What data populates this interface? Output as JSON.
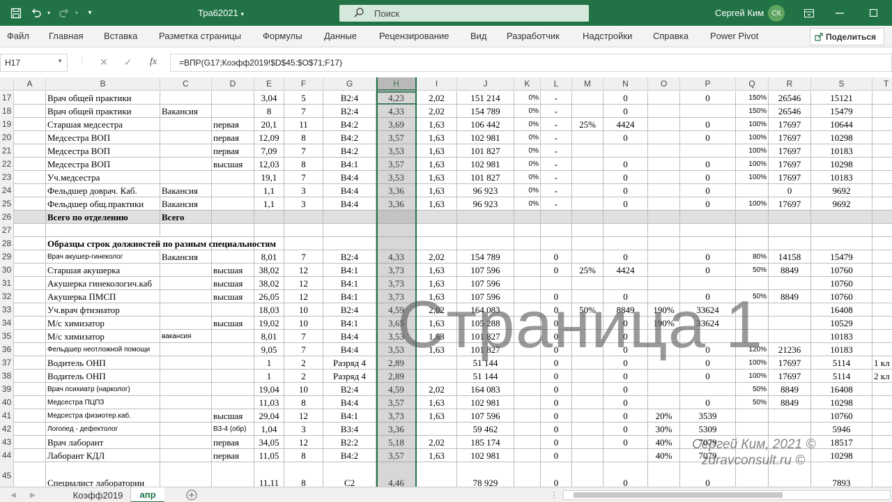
{
  "titlebar": {
    "file_title": "Тра62021",
    "search_placeholder": "Поиск",
    "user_name": "Сергей Ким",
    "user_initials": "СК",
    "save_icon": "save-icon",
    "undo_icon": "undo-icon",
    "redo_icon": "redo-icon",
    "customize_icon": "chevron-down-icon",
    "ribbon_display_icon": "ribbon-display-icon",
    "minimize_icon": "minimize-icon",
    "maximize_icon": "maximize-icon",
    "accent_color": "#217346"
  },
  "ribbon": {
    "tabs": [
      "Файл",
      "Главная",
      "Вставка",
      "Разметка страницы",
      "Формулы",
      "Данные",
      "Рецензирование",
      "Вид",
      "Разработчик",
      "Надстройки",
      "Справка",
      "Power Pivot"
    ],
    "share_label": "Поделиться"
  },
  "formula_bar": {
    "cell_ref": "H17",
    "fx_label": "fx",
    "formula": "=ВПР(G17;Коэфф2019!$D$45:$O$71;F17)"
  },
  "grid": {
    "columns": [
      "A",
      "B",
      "C",
      "D",
      "E",
      "F",
      "G",
      "H",
      "I",
      "J",
      "K",
      "L",
      "M",
      "N",
      "O",
      "P",
      "Q",
      "R",
      "S",
      "T"
    ],
    "selected_column": "H",
    "rows": [
      {
        "num": "17",
        "cells": [
          "",
          "Врач общей практики",
          "",
          "",
          "3,04",
          "5",
          "В2:4",
          "4,23",
          "2,02",
          "151 214",
          "0%",
          "-",
          "",
          "0",
          "",
          "0",
          "150%",
          "26546",
          "15121",
          ""
        ]
      },
      {
        "num": "18",
        "cells": [
          "",
          "Врач общей практики",
          "Вакансия",
          "",
          "8",
          "7",
          "В2:4",
          "4,33",
          "2,02",
          "154 789",
          "0%",
          "-",
          "",
          "0",
          "",
          "",
          "150%",
          "26546",
          "15479",
          ""
        ]
      },
      {
        "num": "19",
        "cells": [
          "",
          "Старшая медсестра",
          "",
          "первая",
          "20,1",
          "11",
          "В4:2",
          "3,69",
          "1,63",
          "106 442",
          "0%",
          "-",
          "25%",
          "4424",
          "",
          "0",
          "100%",
          "17697",
          "10644",
          ""
        ]
      },
      {
        "num": "20",
        "cells": [
          "",
          "Медсестра ВОП",
          "",
          "первая",
          "12,09",
          "8",
          "В4:2",
          "3,57",
          "1,63",
          "102 981",
          "0%",
          "-",
          "",
          "0",
          "",
          "0",
          "100%",
          "17697",
          "10298",
          ""
        ]
      },
      {
        "num": "21",
        "cells": [
          "",
          "Медсестра ВОП",
          "",
          "первая",
          "7,09",
          "7",
          "В4:2",
          "3,53",
          "1,63",
          "101 827",
          "0%",
          "-",
          "",
          "",
          "",
          "",
          "100%",
          "17697",
          "10183",
          ""
        ]
      },
      {
        "num": "22",
        "cells": [
          "",
          "Медсестра ВОП",
          "",
          "высшая",
          "12,03",
          "8",
          "В4:1",
          "3,57",
          "1,63",
          "102 981",
          "0%",
          "-",
          "",
          "0",
          "",
          "0",
          "100%",
          "17697",
          "10298",
          ""
        ]
      },
      {
        "num": "23",
        "cells": [
          "",
          "Уч.медсестра",
          "",
          "",
          "19,1",
          "7",
          "В4:4",
          "3,53",
          "1,63",
          "101 827",
          "0%",
          "-",
          "",
          "0",
          "",
          "0",
          "100%",
          "17697",
          "10183",
          ""
        ]
      },
      {
        "num": "24",
        "cells": [
          "",
          "Фельдшер доврач. Каб.",
          "Вакансия",
          "",
          "1,1",
          "3",
          "В4:4",
          "3,36",
          "1,63",
          "96 923",
          "0%",
          "-",
          "",
          "0",
          "",
          "0",
          "",
          "0",
          "9692",
          ""
        ]
      },
      {
        "num": "25",
        "cells": [
          "",
          "Фельдшер общ.практики",
          "Вакансия",
          "",
          "1,1",
          "3",
          "В4:4",
          "3,36",
          "1,63",
          "96 923",
          "0%",
          "-",
          "",
          "0",
          "",
          "0",
          "100%",
          "17697",
          "9692",
          ""
        ]
      },
      {
        "num": "26",
        "cells": [
          "",
          "Всего по отделению",
          "Всего",
          "",
          "",
          "",
          "",
          "",
          "",
          "",
          "",
          "",
          "",
          "",
          "",
          "",
          "",
          "",
          "",
          ""
        ]
      },
      {
        "num": "27",
        "cells": [
          "",
          "",
          "",
          "",
          "",
          "",
          "",
          "",
          "",
          "",
          "",
          "",
          "",
          "",
          "",
          "",
          "",
          "",
          "",
          ""
        ]
      },
      {
        "num": "28",
        "cells": [
          "",
          "Образцы строк должностей по разным специальностям",
          "",
          "",
          "",
          "",
          "",
          "",
          "",
          "",
          "",
          "",
          "",
          "",
          "",
          "",
          "",
          "",
          "",
          ""
        ]
      },
      {
        "num": "29",
        "cells": [
          "",
          "Врач акушер-гинеколог",
          "Вакансия",
          "",
          "8,01",
          "7",
          "В2:4",
          "4,33",
          "2,02",
          "154 789",
          "",
          "0",
          "",
          "0",
          "",
          "0",
          "80%",
          "14158",
          "15479",
          ""
        ]
      },
      {
        "num": "30",
        "cells": [
          "",
          "Старшая акушерка",
          "",
          "высшая",
          "38,02",
          "12",
          "В4:1",
          "3,73",
          "1,63",
          "107 596",
          "",
          "0",
          "25%",
          "4424",
          "",
          "0",
          "50%",
          "8849",
          "10760",
          ""
        ]
      },
      {
        "num": "31",
        "cells": [
          "",
          "Акушерка гинекологич.каб",
          "",
          "высшая",
          "38,02",
          "12",
          "В4:1",
          "3,73",
          "1,63",
          "107 596",
          "",
          "",
          "",
          "",
          "",
          "",
          "",
          "",
          "10760",
          ""
        ]
      },
      {
        "num": "32",
        "cells": [
          "",
          "Акушерка ПМСП",
          "",
          "высшая",
          "26,05",
          "12",
          "В4:1",
          "3,73",
          "1,63",
          "107 596",
          "",
          "0",
          "",
          "0",
          "",
          "0",
          "50%",
          "8849",
          "10760",
          ""
        ]
      },
      {
        "num": "33",
        "cells": [
          "",
          "Уч.врач фтизиатор",
          "",
          "",
          "18,03",
          "10",
          "В2:4",
          "4,59",
          "2,02",
          "164 083",
          "",
          "0",
          "50%",
          "8849",
          "190%",
          "33624",
          "",
          "",
          "16408",
          ""
        ]
      },
      {
        "num": "34",
        "cells": [
          "",
          "М/с химизатор",
          "",
          "высшая",
          "19,02",
          "10",
          "В4:1",
          "3,65",
          "1,63",
          "105 288",
          "",
          "0",
          "",
          "0",
          "190%",
          "33624",
          "",
          "",
          "10529",
          ""
        ]
      },
      {
        "num": "35",
        "cells": [
          "",
          "М/с химизатор",
          "вакансия",
          "",
          "8,01",
          "7",
          "В4:4",
          "3,53",
          "1,63",
          "101 827",
          "",
          "0",
          "",
          "0",
          "",
          "",
          "",
          "",
          "10183",
          ""
        ]
      },
      {
        "num": "36",
        "cells": [
          "",
          "Фельдшер неотложной помощи",
          "",
          "",
          "9,05",
          "7",
          "В4:4",
          "3,53",
          "1,63",
          "101 827",
          "",
          "0",
          "",
          "0",
          "",
          "0",
          "120%",
          "21236",
          "10183",
          ""
        ]
      },
      {
        "num": "37",
        "cells": [
          "",
          "Водитель ОНП",
          "",
          "",
          "1",
          "2",
          "Разряд 4",
          "2,89",
          "",
          "51 144",
          "",
          "0",
          "",
          "0",
          "",
          "0",
          "100%",
          "17697",
          "5114",
          "1 кл"
        ]
      },
      {
        "num": "38",
        "cells": [
          "",
          "Водитель ОНП",
          "",
          "",
          "1",
          "2",
          "Разряд 4",
          "2,89",
          "",
          "51 144",
          "",
          "0",
          "",
          "0",
          "",
          "0",
          "100%",
          "17697",
          "5114",
          "2 кл"
        ]
      },
      {
        "num": "39",
        "cells": [
          "",
          "Врач психиатр (нарколог)",
          "",
          "",
          "19,04",
          "10",
          "В2:4",
          "4,59",
          "2,02",
          "164 083",
          "",
          "0",
          "",
          "0",
          "",
          "",
          "50%",
          "8849",
          "16408",
          ""
        ]
      },
      {
        "num": "40",
        "cells": [
          "",
          "Медсестра ПЦПЗ",
          "",
          "",
          "11,03",
          "8",
          "В4:4",
          "3,57",
          "1,63",
          "102 981",
          "",
          "0",
          "",
          "0",
          "",
          "0",
          "50%",
          "8849",
          "10298",
          ""
        ]
      },
      {
        "num": "41",
        "cells": [
          "",
          "Медсестра физиотер.каб.",
          "",
          "высшая",
          "29,04",
          "12",
          "В4:1",
          "3,73",
          "1,63",
          "107 596",
          "",
          "0",
          "",
          "0",
          "20%",
          "3539",
          "",
          "",
          "10760",
          ""
        ]
      },
      {
        "num": "42",
        "cells": [
          "",
          "Логопед - дефектолог",
          "",
          "В3-4 (обр)",
          "1,04",
          "3",
          "В3:4",
          "3,36",
          "",
          "59 462",
          "",
          "0",
          "",
          "0",
          "30%",
          "5309",
          "",
          "",
          "5946",
          ""
        ]
      },
      {
        "num": "43",
        "cells": [
          "",
          "Врач лаборант",
          "",
          "первая",
          "34,05",
          "12",
          "В2:2",
          "5,18",
          "2,02",
          "185 174",
          "",
          "0",
          "",
          "0",
          "40%",
          "7079",
          "",
          "",
          "18517",
          ""
        ]
      },
      {
        "num": "44",
        "cells": [
          "",
          "Лаборант КДЛ",
          "",
          "первая",
          "11,05",
          "8",
          "В4:2",
          "3,57",
          "1,63",
          "102 981",
          "",
          "0",
          "",
          "",
          "40%",
          "7079",
          "",
          "",
          "10298",
          ""
        ]
      },
      {
        "num": "45",
        "cells": [
          "",
          "Специалист лаборатории",
          "",
          "",
          "11,11",
          "8",
          "С2",
          "4,46",
          "",
          "78 929",
          "",
          "0",
          "",
          "0",
          "",
          "0",
          "",
          "",
          "7893",
          ""
        ]
      }
    ]
  },
  "overlay": {
    "watermark": "Страница 1",
    "copyright_line1": "Сергей  Ким, 2021 ©",
    "copyright_line2": "zdravconsult.ru ©"
  },
  "sheets": {
    "tabs": [
      "Коэфф2019",
      "апр"
    ],
    "active": "апр",
    "add_icon": "plus-icon"
  }
}
